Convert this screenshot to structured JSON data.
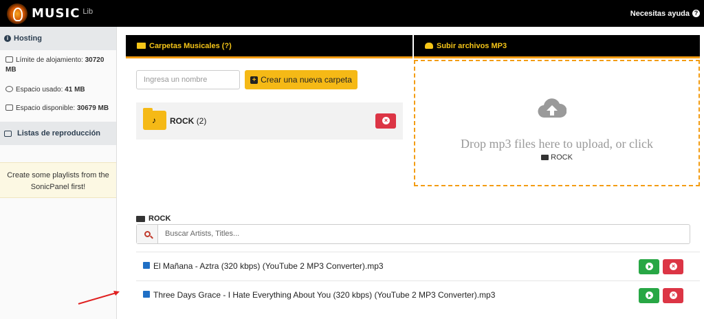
{
  "topbar": {
    "brand": "MUSIC",
    "brand_sub": "Lib",
    "help_label": "Necesitas ayuda"
  },
  "sidebar": {
    "hosting_title": "Hosting",
    "limit_label": "Límite de alojamiento:",
    "limit_value": "30720 MB",
    "used_label": "Espacio usado:",
    "used_value": "41 MB",
    "available_label": "Espacio disponible:",
    "available_value": "30679 MB",
    "playlists_title": "Listas de reproducción",
    "playlists_notice": "Create some playlists from the SonicPanel first!"
  },
  "folders_panel": {
    "title": "Carpetas Musicales (?)",
    "name_placeholder": "Ingresa un nombre",
    "create_label": "Crear una nueva carpeta",
    "folder_name": "ROCK",
    "folder_count": "(2)"
  },
  "upload_panel": {
    "title": "Subir archivos MP3",
    "drop_text": "Drop mp3 files here to upload, or click",
    "drop_folder": "ROCK"
  },
  "tracks_section": {
    "folder_label": "ROCK",
    "search_placeholder": "Buscar Artists, Titles...",
    "tracks": [
      {
        "name": "El Mañana - Aztra (320 kbps) (YouTube 2 MP3 Converter).mp3"
      },
      {
        "name": "Three Days Grace - I Hate Everything About You (320 kbps) (YouTube 2 MP3 Converter).mp3"
      }
    ]
  },
  "colors": {
    "accent": "#f39c12",
    "button_yellow": "#f5b916",
    "danger": "#dc3545",
    "success": "#28a745",
    "annotation_arrow": "#e02020"
  }
}
